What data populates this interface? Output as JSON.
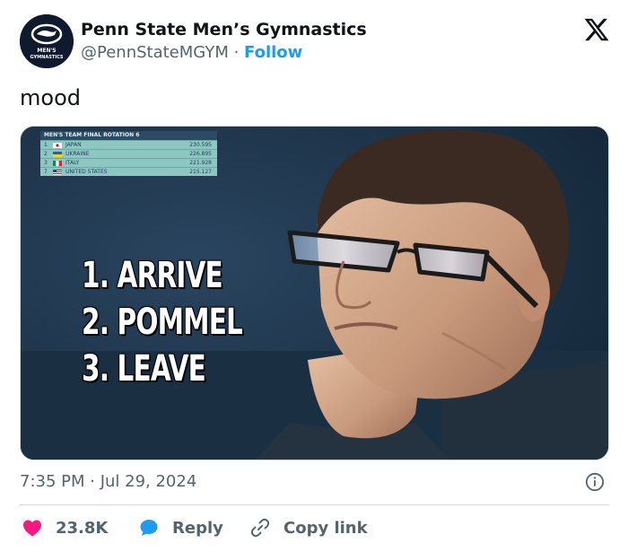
{
  "account": {
    "display_name": "Penn State Men’s Gymnastics",
    "handle": "@PennStateMGYM",
    "separator": " · ",
    "follow_label": "Follow",
    "avatar_text_line1": "MEN'S",
    "avatar_text_line2": "GYMNASTICS"
  },
  "tweet": {
    "text": "mood",
    "timestamp": "7:35 PM · Jul 29, 2024"
  },
  "media": {
    "scoreboard": {
      "title": "MEN'S TEAM FINAL  ROTATION 6",
      "rows": [
        {
          "rank": "1",
          "country": "JAPAN",
          "score": "230.595",
          "flag": "japan-flag"
        },
        {
          "rank": "2",
          "country": "UKRAINE",
          "score": "226.895",
          "flag": "ukraine-flag"
        },
        {
          "rank": "3",
          "country": "ITALY",
          "score": "221.928",
          "flag": "italy-flag"
        },
        {
          "rank": "7",
          "country": "UNITED STATES",
          "score": "215.127",
          "flag": "usa-flag"
        }
      ]
    },
    "steps": [
      "1. ARRIVE",
      "2. POMMEL",
      "3. LEAVE"
    ]
  },
  "actions": {
    "like_count": "23.8K",
    "reply_label": "Reply",
    "copy_label": "Copy link"
  },
  "icons": {
    "logo": "x-logo-icon",
    "info": "info-icon",
    "like": "heart-icon",
    "reply": "speech-bubble-icon",
    "copy": "link-icon"
  },
  "colors": {
    "accent": "#1d9bf0",
    "like": "#f91880",
    "muted": "#536471",
    "text": "#0f1419"
  }
}
